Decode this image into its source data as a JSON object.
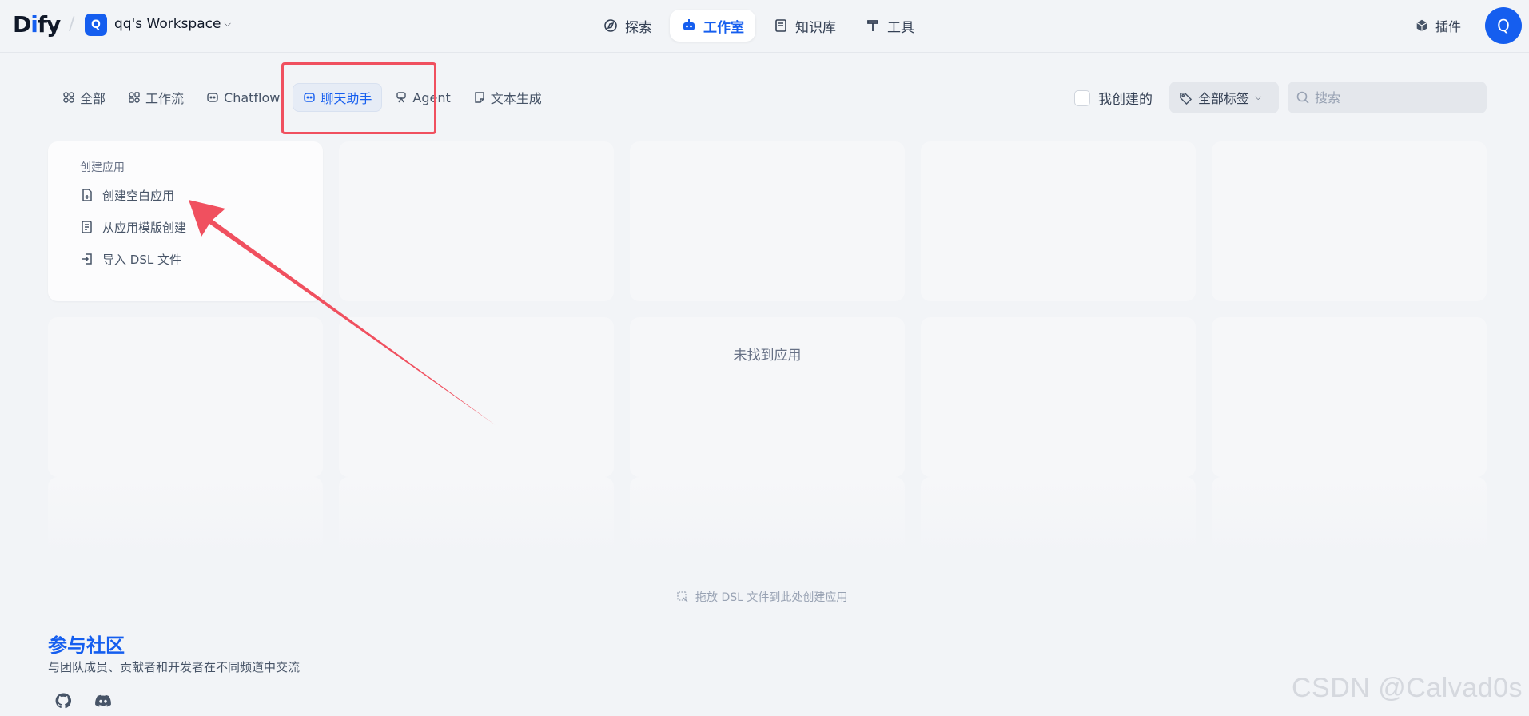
{
  "header": {
    "logo_main": "D",
    "logo_i": "i",
    "logo_rest": "fy",
    "workspace_initial": "Q",
    "workspace_name": "qq's Workspace",
    "nav": [
      {
        "label": "探索",
        "icon": "compass-icon"
      },
      {
        "label": "工作室",
        "icon": "robot-icon",
        "active": true
      },
      {
        "label": "知识库",
        "icon": "book-icon"
      },
      {
        "label": "工具",
        "icon": "hammer-icon"
      }
    ],
    "plugins_label": "插件",
    "user_initial": "Q"
  },
  "filters": {
    "tabs": [
      {
        "label": "全部",
        "icon": "grid-icon"
      },
      {
        "label": "工作流",
        "icon": "workflow-icon"
      },
      {
        "label": "Chatflow",
        "icon": "chatflow-icon"
      },
      {
        "label": "聊天助手",
        "icon": "chat-bot-icon",
        "active": true
      },
      {
        "label": "Agent",
        "icon": "agent-icon"
      },
      {
        "label": "文本生成",
        "icon": "note-icon"
      }
    ],
    "mine_label": "我创建的",
    "tag_select_label": "全部标签",
    "search_placeholder": "搜索"
  },
  "create_card": {
    "title": "创建应用",
    "items": [
      {
        "label": "创建空白应用",
        "icon": "file-plus-icon"
      },
      {
        "label": "从应用模版创建",
        "icon": "template-icon"
      },
      {
        "label": "导入 DSL 文件",
        "icon": "import-icon"
      }
    ]
  },
  "empty_text": "未找到应用",
  "drop_hint": "拖放 DSL 文件到此处创建应用",
  "community": {
    "title": "参与社区",
    "description": "与团队成员、贡献者和开发者在不同频道中交流"
  },
  "watermark": "CSDN @Calvad0s",
  "colors": {
    "accent": "#155eef",
    "annotation_red": "#f0505f",
    "background": "#f2f4f7"
  }
}
